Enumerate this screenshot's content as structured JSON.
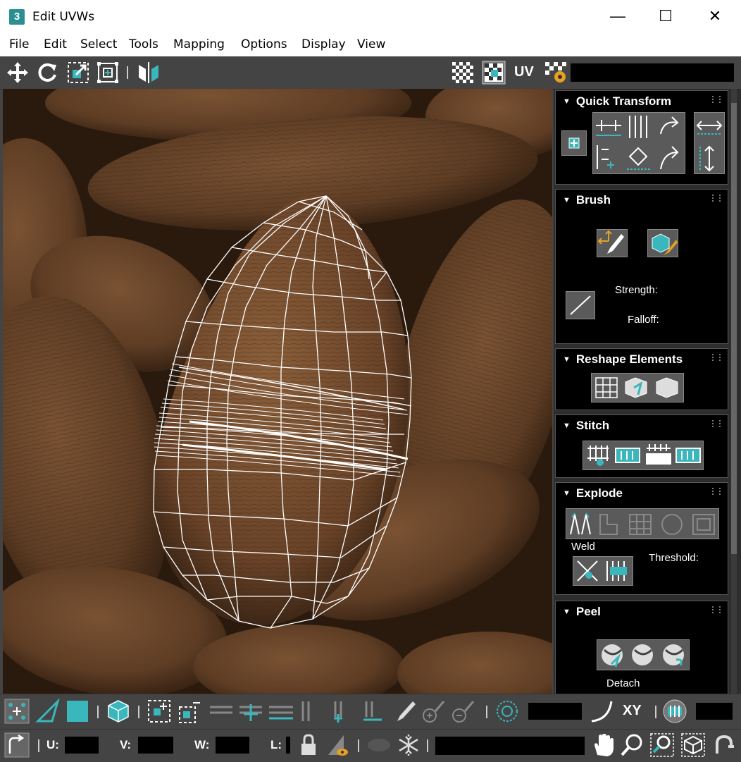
{
  "window": {
    "title": "Edit UVWs",
    "app_icon_text": "3",
    "minimize_glyph": "—",
    "maximize_glyph": "☐",
    "close_glyph": "✕"
  },
  "menu": [
    "File",
    "Edit",
    "Select",
    "Tools",
    "Mapping",
    "Options",
    "Display",
    "View"
  ],
  "top_toolbar": {
    "icons": [
      "move-icon",
      "rotate-icon",
      "scale-icon",
      "freeform-icon",
      "mirror-icon"
    ],
    "right_icons": [
      "checker-icon",
      "texture-checker-icon",
      "uv-label-icon",
      "settings-checker-icon"
    ],
    "uv_label": "UV"
  },
  "rollouts": {
    "quick_transform": {
      "title": "Quick Transform"
    },
    "brush": {
      "title": "Brush",
      "strength_label": "Strength:",
      "falloff_label": "Falloff:"
    },
    "reshape_elements": {
      "title": "Reshape Elements"
    },
    "stitch": {
      "title": "Stitch"
    },
    "explode": {
      "title": "Explode",
      "weld_label": "Weld",
      "threshold_label": "Threshold:"
    },
    "peel": {
      "title": "Peel",
      "detach_label": "Detach"
    }
  },
  "bottom_toolbar": {
    "xy_label": "XY",
    "u_label": "U:",
    "v_label": "V:",
    "w_label": "W:",
    "l_label": "L:"
  },
  "colors": {
    "accent": "#39b7bd",
    "panel_bg": "#000000",
    "toolbar_bg": "#444444",
    "wire": "#ffffff"
  }
}
